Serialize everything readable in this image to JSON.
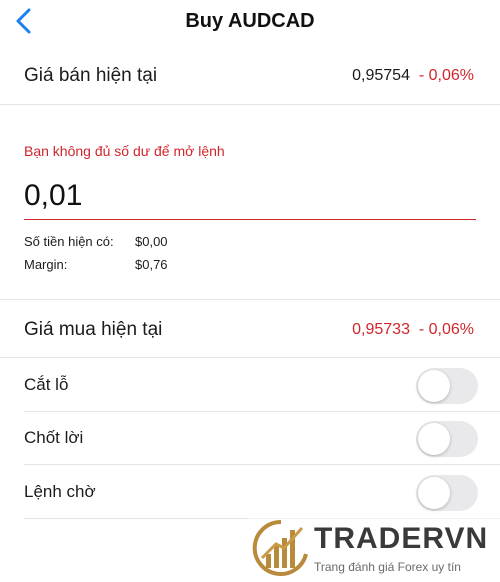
{
  "nav": {
    "back_icon": "chevron-left-icon",
    "title": "Buy AUDCAD",
    "accent": "#1a7ff0"
  },
  "sell": {
    "label": "Giá bán hiện tại",
    "price": "0,95754",
    "change": "- 0,06%"
  },
  "order": {
    "error": "Bạn không đủ số dư để mở lệnh",
    "quantity": "0,01",
    "balance_label": "Số tiền hiện có:",
    "balance_value": "$0,00",
    "margin_label": "Margin:",
    "margin_value": "$0,76"
  },
  "buy": {
    "label": "Giá mua hiện tại",
    "price": "0,95733",
    "change": "- 0,06%"
  },
  "options": [
    {
      "label": "Cắt lỗ",
      "enabled": false
    },
    {
      "label": "Chốt lời",
      "enabled": false
    },
    {
      "label": "Lệnh chờ",
      "enabled": false
    }
  ],
  "watermark": {
    "brand": "TRADERVN",
    "tagline": "Trang đánh giá Forex uy tín"
  },
  "colors": {
    "negative": "#d0262c",
    "separator": "#e4e4e6",
    "toggle_off": "#e9e9eb",
    "watermark_gold": "#b88a3c"
  }
}
